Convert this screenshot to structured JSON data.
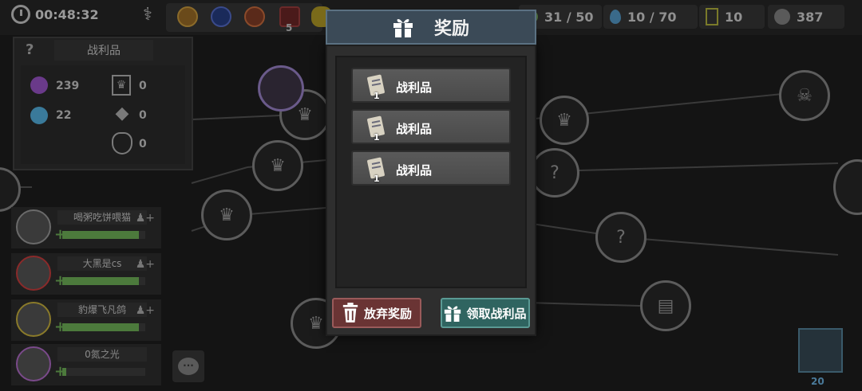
{
  "topbar": {
    "timer": "00:48:32",
    "relic_count": "5",
    "stats": [
      {
        "icon": "coin-stack-icon",
        "value": "31 / 50"
      },
      {
        "icon": "water-drop-icon",
        "value": "10 / 70"
      },
      {
        "icon": "card-icon",
        "value": "10"
      },
      {
        "icon": "gem-icon",
        "value": "387"
      }
    ]
  },
  "loot_panel": {
    "help": "?",
    "title": "战利品",
    "entries": [
      {
        "icon": "potion-icon",
        "value": "239"
      },
      {
        "icon": "crystal-icon",
        "value": "22"
      },
      {
        "icon": "crown-card-icon",
        "value": "0"
      },
      {
        "icon": "mystery-icon",
        "value": "0"
      },
      {
        "icon": "money-bag-icon",
        "value": "0"
      }
    ]
  },
  "party": [
    {
      "name": "喝粥吃饼喂猫",
      "hp": 0.92
    },
    {
      "name": "大黑是cs",
      "hp": 0.92
    },
    {
      "name": "豹爆飞凡鸽",
      "hp": 0.92
    },
    {
      "name": "0氮之光",
      "hp": 0.05
    }
  ],
  "portrait_counter": "20",
  "modal": {
    "title": "奖励",
    "items": [
      {
        "label": "战利品",
        "qty": "1",
        "icon": "scroll-icon"
      },
      {
        "label": "战利品",
        "qty": "1",
        "icon": "scroll-icon"
      },
      {
        "label": "战利品",
        "qty": "1",
        "icon": "scroll-icon"
      }
    ],
    "discard_label": "放弃奖励",
    "claim_label": "领取战利品"
  },
  "colors": {
    "header": "#3b4a57",
    "discard": "#6a3434",
    "claim": "#2f6460",
    "hp": "#4c7a3c"
  }
}
